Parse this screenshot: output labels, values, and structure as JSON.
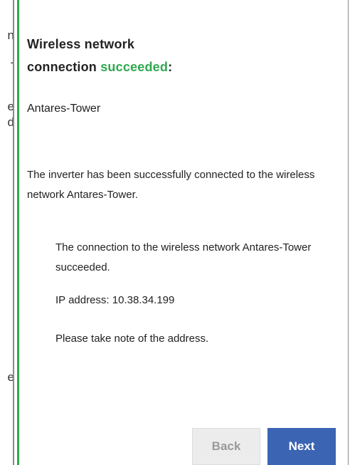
{
  "background_fragments": [
    "n",
    "-",
    "e",
    "d",
    "e"
  ],
  "dialog": {
    "title_line1": "Wireless network",
    "title_line2_prefix": "connection ",
    "title_status": "succeeded",
    "title_suffix": ":",
    "network_name": "Antares-Tower",
    "description": "The inverter has been successfully connected to the wireless network Antares-Tower.",
    "detail_connection": "The connection to the wireless network Antares-Tower succeeded.",
    "detail_ip": "IP address: 10.38.34.199",
    "detail_note": "Please take note of the address."
  },
  "buttons": {
    "back_label": "Back",
    "next_label": "Next"
  },
  "colors": {
    "success": "#2fa84f",
    "primary": "#3b64b3",
    "disabled_bg": "#ececec"
  }
}
